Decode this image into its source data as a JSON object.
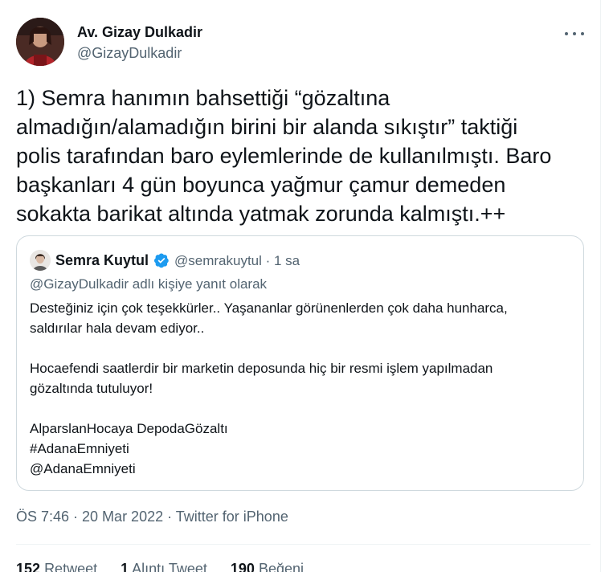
{
  "author": {
    "name": "Av. Gizay Dulkadir",
    "handle": "@GizayDulkadir"
  },
  "tweet": {
    "lines": [
      "1) Semra hanımın bahsettiği “gözaltına",
      "almadığın/alamadığın birini bir alanda sıkıştır” taktiği",
      "polis tarafından baro eylemlerinde de kullanılmıştı. Baro",
      "başkanları 4 gün boyunca yağmur çamur demeden",
      "sokakta barikat altında yatmak zorunda kalmıştı.++"
    ]
  },
  "quote": {
    "name": "Semra Kuytul",
    "handle_time": "@semrakuytul · 1 sa",
    "reply_to": "@GizayDulkadir adlı kişiye yanıt olarak",
    "body": {
      "line1": "Desteğiniz için çok teşekkürler.. Yaşananlar görünenlerden çok daha hunharca,",
      "line2": "saldırılar hala devam ediyor..",
      "line3": "Hocaefendi saatlerdir bir marketin deposunda hiç bir resmi işlem yapılmadan",
      "line4": "gözaltında tutuluyor!",
      "line5": "AlparslanHocaya DepodaGözaltı",
      "line6": "#AdanaEmniyeti",
      "line7": "@AdanaEmniyeti"
    },
    "verified_icon": "verified-badge-icon",
    "verified_color": "#1d9bf0"
  },
  "meta": "ÖS 7:46 · 20 Mar 2022 · Twitter for iPhone",
  "stats": {
    "retweets_count": "152",
    "retweets_label": "Retweet",
    "quotes_count": "1",
    "quotes_label": "Alıntı Tweet",
    "likes_count": "190",
    "likes_label": "Beğeni"
  },
  "colors": {
    "text": "#0f1419",
    "secondary": "#536471",
    "border": "#cfd9de"
  }
}
